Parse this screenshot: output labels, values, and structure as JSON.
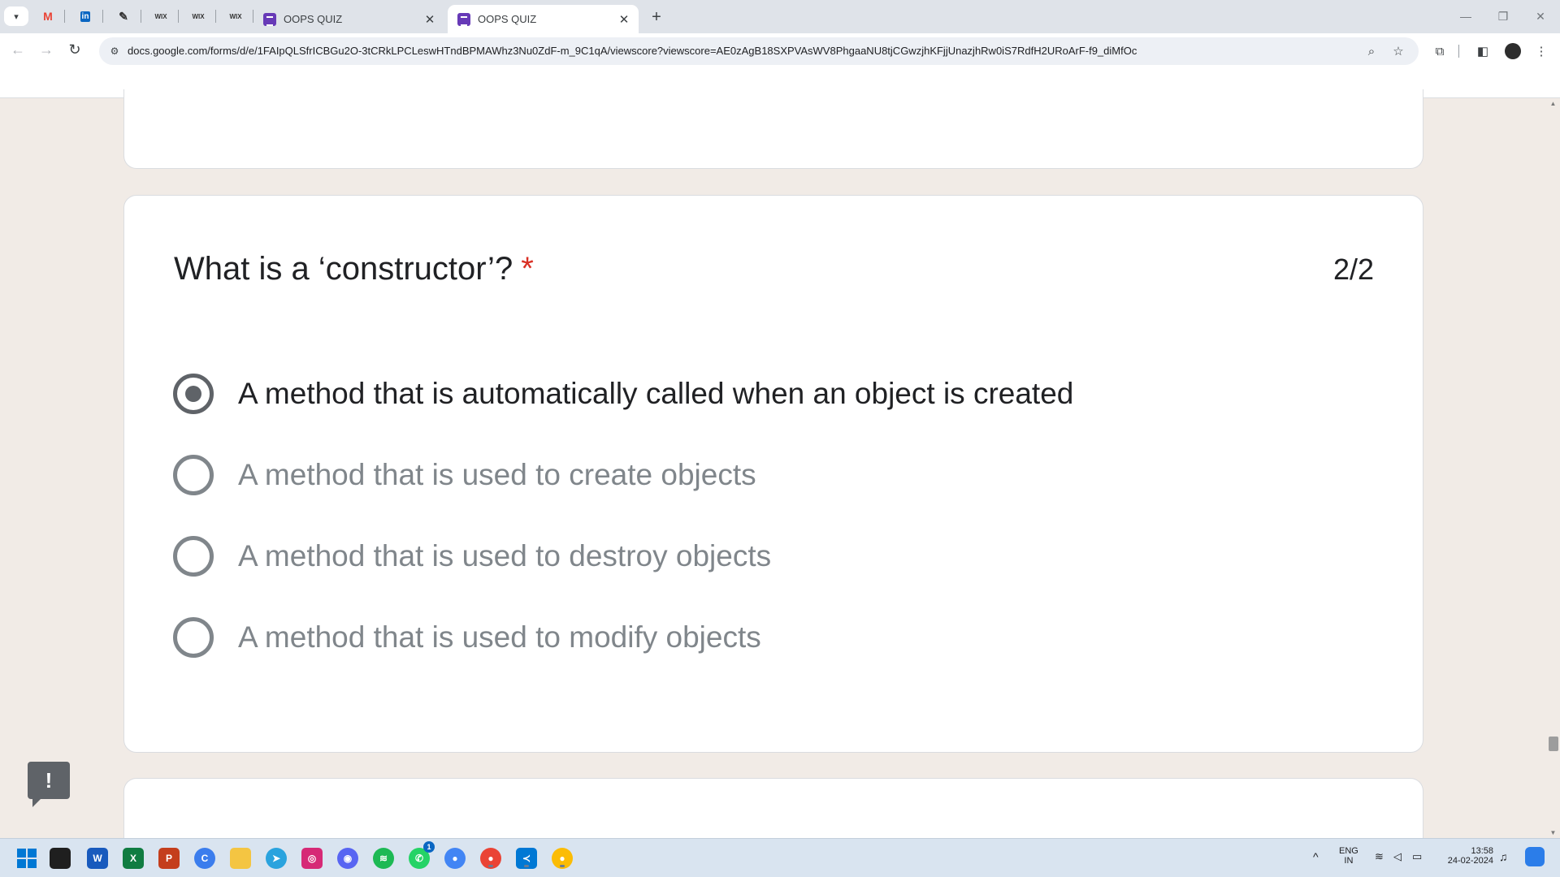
{
  "browser": {
    "pinned_tabs": [
      {
        "icon": "gmail-icon",
        "glyph": "M"
      },
      {
        "icon": "linkedin-icon",
        "glyph": "in"
      },
      {
        "icon": "quill-icon",
        "glyph": "✎"
      },
      {
        "icon": "wix-icon",
        "glyph": "WIX"
      },
      {
        "icon": "wix-icon",
        "glyph": "WIX"
      },
      {
        "icon": "wix-icon",
        "glyph": "WIX"
      }
    ],
    "tabs": [
      {
        "title": "OOPS QUIZ",
        "active": false
      },
      {
        "title": "OOPS QUIZ",
        "active": true
      }
    ],
    "url": "docs.google.com/forms/d/e/1FAIpQLSfrICBGu2O-3tCRkLPCLeswHTndBPMAWhz3Nu0ZdF-m_9C1qA/viewscore?viewscore=AE0zAgB18SXPVAsWV8PhgaaNU8tjCGwzjhKFjjUnazjhRw0iS7RdfH2URoArF-f9_diMfOc"
  },
  "question": {
    "title": "What is a ‘constructor’?",
    "required_marker": "*",
    "score": "2/2",
    "options": [
      {
        "label": "A method that is automatically called when an object is created",
        "selected": true
      },
      {
        "label": "A method that is used to create objects",
        "selected": false
      },
      {
        "label": "A method that is used to destroy objects",
        "selected": false
      },
      {
        "label": "A method that is used to modify objects",
        "selected": false
      }
    ]
  },
  "feedback": {
    "glyph": "!"
  },
  "taskbar": {
    "apps": [
      "start-icon",
      "file-explorer-icon",
      "word-icon",
      "excel-icon",
      "powerpoint-icon",
      "cortana-icon",
      "folder-icon",
      "telegram-icon",
      "instagram-icon",
      "discord-icon",
      "spotify-icon",
      "whatsapp-icon",
      "chrome-icon",
      "chrome-profile-icon",
      "vscode-icon",
      "chrome-profile-icon"
    ],
    "whatsapp_badge": "1",
    "language": "ENG",
    "region": "IN",
    "time": "13:58",
    "date": "24-02-2024"
  },
  "colors": {
    "page_background": "#f1ebe6",
    "required_red": "#d93025",
    "forms_purple": "#673ab7"
  }
}
